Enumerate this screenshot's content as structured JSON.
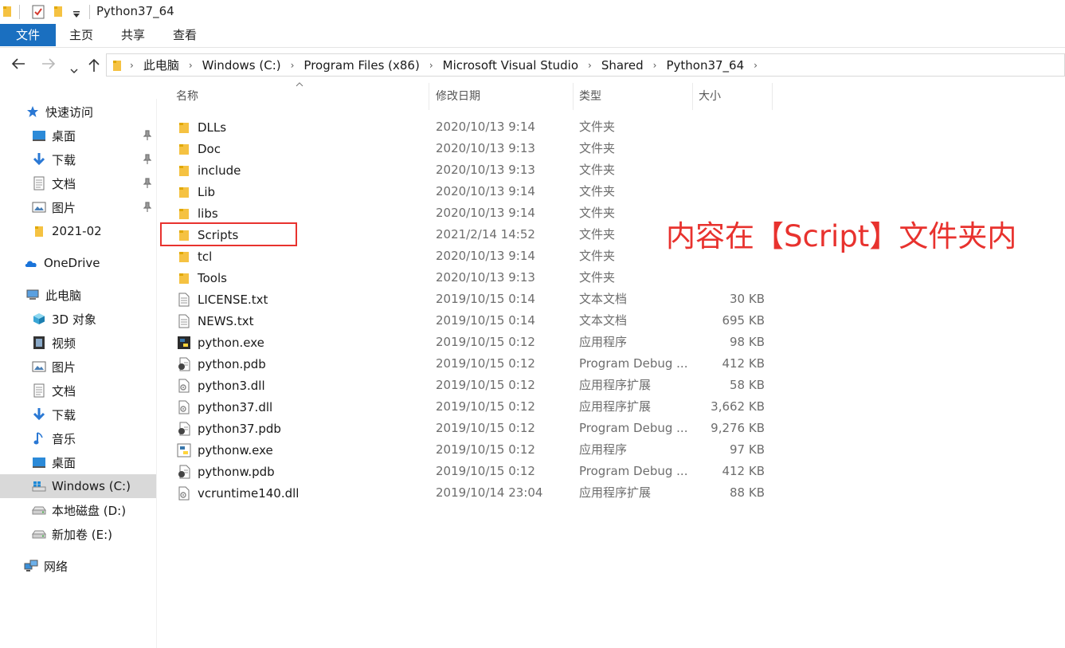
{
  "window": {
    "title": "Python37_64"
  },
  "ribbon": {
    "tabs": [
      "文件",
      "主页",
      "共享",
      "查看"
    ]
  },
  "address": {
    "crumbs": [
      "此电脑",
      "Windows (C:)",
      "Program Files (x86)",
      "Microsoft Visual Studio",
      "Shared",
      "Python37_64"
    ]
  },
  "sidebar": {
    "items": [
      {
        "label": "快速访问",
        "icon": "star-icon"
      },
      {
        "label": "桌面",
        "icon": "desktop-icon",
        "pinned": true
      },
      {
        "label": "下载",
        "icon": "download-icon",
        "pinned": true
      },
      {
        "label": "文档",
        "icon": "document-icon",
        "pinned": true
      },
      {
        "label": "图片",
        "icon": "pictures-icon",
        "pinned": true
      },
      {
        "label": "2021-02",
        "icon": "folder-icon"
      },
      {
        "label": "OneDrive",
        "icon": "cloud-icon"
      },
      {
        "label": "此电脑",
        "icon": "computer-icon"
      },
      {
        "label": "3D 对象",
        "icon": "cube-icon"
      },
      {
        "label": "视频",
        "icon": "video-icon"
      },
      {
        "label": "图片",
        "icon": "pictures-icon"
      },
      {
        "label": "文档",
        "icon": "document-icon"
      },
      {
        "label": "下载",
        "icon": "download-icon"
      },
      {
        "label": "音乐",
        "icon": "music-icon"
      },
      {
        "label": "桌面",
        "icon": "desktop-icon"
      },
      {
        "label": "Windows (C:)",
        "icon": "windows-drive-icon",
        "selected": true
      },
      {
        "label": "本地磁盘 (D:)",
        "icon": "drive-icon"
      },
      {
        "label": "新加卷 (E:)",
        "icon": "drive-icon"
      },
      {
        "label": "网络",
        "icon": "network-icon"
      }
    ]
  },
  "columns": {
    "name": "名称",
    "date": "修改日期",
    "type": "类型",
    "size": "大小"
  },
  "files": [
    {
      "name": "DLLs",
      "date": "2020/10/13 9:14",
      "type": "文件夹",
      "size": "",
      "icon": "folder-icon"
    },
    {
      "name": "Doc",
      "date": "2020/10/13 9:13",
      "type": "文件夹",
      "size": "",
      "icon": "folder-icon"
    },
    {
      "name": "include",
      "date": "2020/10/13 9:13",
      "type": "文件夹",
      "size": "",
      "icon": "folder-icon"
    },
    {
      "name": "Lib",
      "date": "2020/10/13 9:14",
      "type": "文件夹",
      "size": "",
      "icon": "folder-icon"
    },
    {
      "name": "libs",
      "date": "2020/10/13 9:14",
      "type": "文件夹",
      "size": "",
      "icon": "folder-icon"
    },
    {
      "name": "Scripts",
      "date": "2021/2/14 14:52",
      "type": "文件夹",
      "size": "",
      "icon": "folder-icon"
    },
    {
      "name": "tcl",
      "date": "2020/10/13 9:14",
      "type": "文件夹",
      "size": "",
      "icon": "folder-icon"
    },
    {
      "name": "Tools",
      "date": "2020/10/13 9:13",
      "type": "文件夹",
      "size": "",
      "icon": "folder-icon"
    },
    {
      "name": "LICENSE.txt",
      "date": "2019/10/15 0:14",
      "type": "文本文档",
      "size": "30 KB",
      "icon": "text-file-icon"
    },
    {
      "name": "NEWS.txt",
      "date": "2019/10/15 0:14",
      "type": "文本文档",
      "size": "695 KB",
      "icon": "text-file-icon"
    },
    {
      "name": "python.exe",
      "date": "2019/10/15 0:12",
      "type": "应用程序",
      "size": "98 KB",
      "icon": "python-exe-icon"
    },
    {
      "name": "python.pdb",
      "date": "2019/10/15 0:12",
      "type": "Program Debug ...",
      "size": "412 KB",
      "icon": "pdb-file-icon"
    },
    {
      "name": "python3.dll",
      "date": "2019/10/15 0:12",
      "type": "应用程序扩展",
      "size": "58 KB",
      "icon": "dll-file-icon"
    },
    {
      "name": "python37.dll",
      "date": "2019/10/15 0:12",
      "type": "应用程序扩展",
      "size": "3,662 KB",
      "icon": "dll-file-icon"
    },
    {
      "name": "python37.pdb",
      "date": "2019/10/15 0:12",
      "type": "Program Debug ...",
      "size": "9,276 KB",
      "icon": "pdb-file-icon"
    },
    {
      "name": "pythonw.exe",
      "date": "2019/10/15 0:12",
      "type": "应用程序",
      "size": "97 KB",
      "icon": "pythonw-exe-icon"
    },
    {
      "name": "pythonw.pdb",
      "date": "2019/10/15 0:12",
      "type": "Program Debug ...",
      "size": "412 KB",
      "icon": "pdb-file-icon"
    },
    {
      "name": "vcruntime140.dll",
      "date": "2019/10/14 23:04",
      "type": "应用程序扩展",
      "size": "88 KB",
      "icon": "dll-file-icon"
    }
  ],
  "annotation": {
    "text": "内容在【Script】文件夹内",
    "color": "#e8322e"
  },
  "colors": {
    "accent": "#1a6fc0",
    "folder": "#f5c242",
    "highlight": "#e8322e",
    "selected_bg": "#d9d9d9"
  }
}
